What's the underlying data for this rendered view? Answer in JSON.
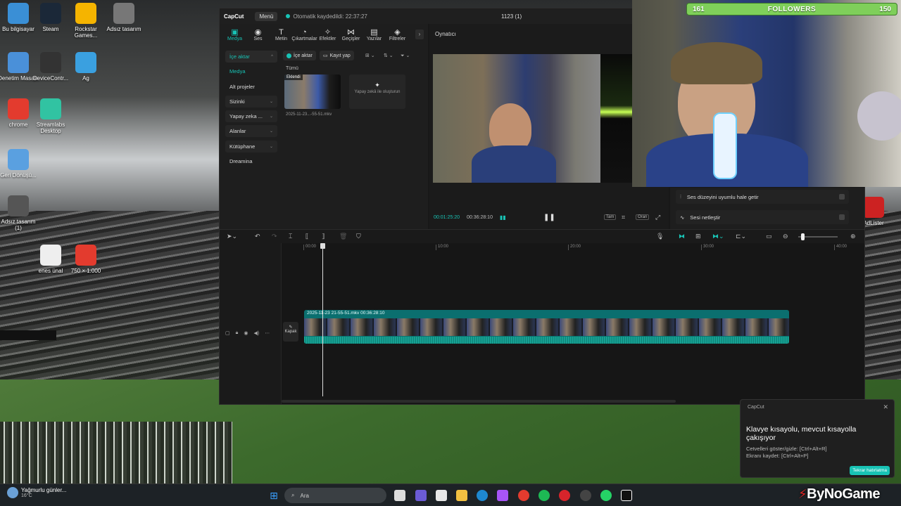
{
  "desktop": {
    "icons": [
      {
        "label": "Bu bilgisayar",
        "icon": "computer-icon",
        "color": "#3a8fd6"
      },
      {
        "label": "Steam",
        "icon": "steam-icon",
        "color": "#1b2838"
      },
      {
        "label": "Rockstar Games...",
        "icon": "rockstar-icon",
        "color": "#f5b400"
      },
      {
        "label": "Adsız tasarım",
        "icon": "image-icon",
        "color": "#777777"
      },
      {
        "label": "Denetim Masası",
        "icon": "control-panel-icon",
        "color": "#4a90d9"
      },
      {
        "label": "DeviceContr...",
        "icon": "keyboard-icon",
        "color": "#333333"
      },
      {
        "label": "Ag",
        "icon": "network-icon",
        "color": "#3aa0e0"
      },
      {
        "label": "chrome",
        "icon": "chrome-icon",
        "color": "#e33b2e"
      },
      {
        "label": "Streamlabs Desktop",
        "icon": "streamlabs-icon",
        "color": "#31c3a2"
      },
      {
        "label": "Geri Dönüşü...",
        "icon": "recycle-bin-icon",
        "color": "#5aa0e0"
      },
      {
        "label": "Adsız tasarım (1)",
        "icon": "image-icon",
        "color": "#555555"
      },
      {
        "label": "enes ünal",
        "icon": "video-file-icon",
        "color": "#eeeeee"
      },
      {
        "label": "750 × 1.000",
        "icon": "chrome-file-icon",
        "color": "#e33b2e"
      },
      {
        "label": "AdLister",
        "icon": "app-icon",
        "color": "#cc2222"
      }
    ]
  },
  "capcut": {
    "app_name": "CapCut",
    "menu_label": "Menü",
    "autosave_text": "Otomatik kaydedildi: 22:37:27",
    "project_title": "1123 (1)",
    "tabs": [
      {
        "label": "Medya",
        "icon": "media-icon",
        "glyph": "▣"
      },
      {
        "label": "Ses",
        "icon": "audio-icon",
        "glyph": "◉"
      },
      {
        "label": "Metin",
        "icon": "text-icon",
        "glyph": "T"
      },
      {
        "label": "Çıkartmalar",
        "icon": "sticker-icon",
        "glyph": "◔"
      },
      {
        "label": "Efektler",
        "icon": "effects-icon",
        "glyph": "✧"
      },
      {
        "label": "Geçişler",
        "icon": "transitions-icon",
        "glyph": "⋈"
      },
      {
        "label": "Yazılar",
        "icon": "captions-icon",
        "glyph": "▤"
      },
      {
        "label": "Filtreler",
        "icon": "filters-icon",
        "glyph": "◈"
      }
    ],
    "sidebar": [
      {
        "label": "İçe aktar",
        "caret": "^"
      },
      {
        "label": "Medya",
        "caret": ""
      },
      {
        "label": "Alt projeler",
        "caret": ""
      },
      {
        "label": "Sizinki",
        "caret": "⌄"
      },
      {
        "label": "Yapay zeka ...",
        "caret": "⌄"
      },
      {
        "label": "Alanlar",
        "caret": "⌄"
      },
      {
        "label": "Kütüphane",
        "caret": "⌄"
      },
      {
        "label": "Dreamina",
        "caret": ""
      }
    ],
    "media": {
      "import_label": "İçe aktar",
      "record_label": "Kayıt yap",
      "all_label": "Tümü",
      "clip_tag": "Eklendi",
      "clip_name": "2025-11-23...-55-51.mkv",
      "ai_create_label": "Yapay zekâ ile oluşturun"
    },
    "player": {
      "title": "Oynatıcı",
      "current_time": "00:01:25:20",
      "duration": "00:36:28:10",
      "full_label": "Tam",
      "ratio_label": "Oran"
    },
    "audio_panel": {
      "row1": "Ses düzeyini uyumlu hale getir",
      "row2": "Sesi netleştir"
    },
    "timeline": {
      "ruler": [
        "00:00",
        "10:00",
        "20:00",
        "30:00",
        "40:00"
      ],
      "cover_label": "Kapak",
      "clip_label": "2025-11-23 21-55-51.mkv   00:36:28:10"
    }
  },
  "overlay": {
    "followers_left": "161",
    "followers_title": "FOLLOWERS",
    "followers_right": "150"
  },
  "toast": {
    "app": "CapCut",
    "title": "Klavye kısayolu, mevcut kısayolla çakışıyor",
    "line1": "Cetvelleri göster/gizle: [Ctrl+Alt+R]",
    "line2": "Ekranı kaydet: [Ctrl+Alt+P]",
    "button": "Tekrar hatırlatma"
  },
  "taskbar": {
    "weather_title": "Yağmurlu günler...",
    "weather_temp": "16°C",
    "search_placeholder": "Ara",
    "watermark": "ByNoGame"
  },
  "colors": {
    "accent": "#18c3b5",
    "followers_green": "#7fcf5a"
  }
}
